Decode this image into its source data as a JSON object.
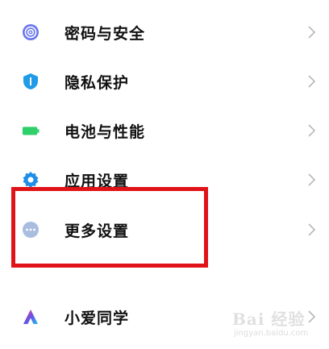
{
  "settings_items": [
    {
      "label": "密码与安全",
      "icon": "fingerprint-icon",
      "color": "#6b78ee"
    },
    {
      "label": "隐私保护",
      "icon": "shield-icon",
      "color": "#1f9be8"
    },
    {
      "label": "电池与性能",
      "icon": "battery-icon",
      "color": "#2fcf6a"
    },
    {
      "label": "应用设置",
      "icon": "gear-icon",
      "color": "#1f8ee8"
    },
    {
      "label": "更多设置",
      "icon": "more-dots-icon",
      "color": "#a9bde0"
    },
    {
      "label": "小爱同学",
      "icon": "xiaoai-icon",
      "color": "#6c4de6"
    }
  ],
  "highlight": {
    "target": "更多设置",
    "color": "#e01418"
  },
  "watermark": {
    "logo_text": "Bai 经验",
    "url": "jingyan.baidu.com"
  }
}
